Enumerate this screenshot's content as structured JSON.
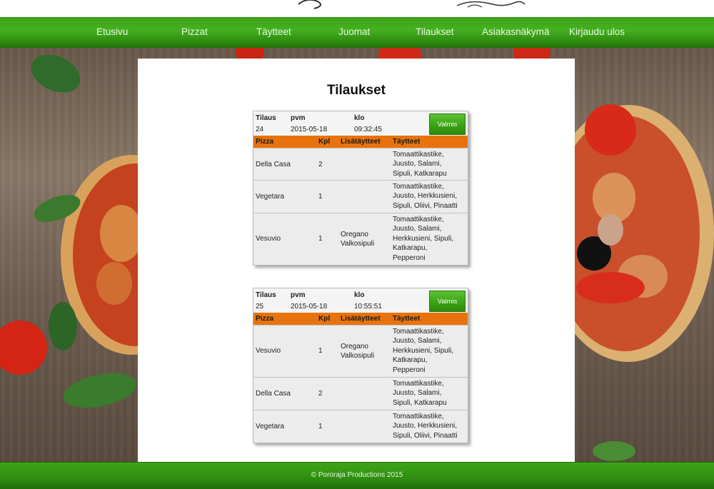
{
  "nav": {
    "items": [
      {
        "label": "Etusivu"
      },
      {
        "label": "Pizzat"
      },
      {
        "label": "Täytteet"
      },
      {
        "label": "Juomat"
      },
      {
        "label": "Tilaukset"
      },
      {
        "label": "Asiakasnäkymä"
      },
      {
        "label": "Kirjaudu ulos"
      }
    ]
  },
  "page": {
    "title": "Tilaukset"
  },
  "labels": {
    "order": "Tilaus",
    "date": "pvm",
    "time": "klo",
    "col_pizza": "Pizza",
    "col_qty": "Kpl",
    "col_extras": "Lisätäytteet",
    "col_toppings": "Täytteet",
    "done_button": "Valmis"
  },
  "orders": [
    {
      "id": "24",
      "date": "2015-05-18",
      "time": "09:32:45",
      "rows": [
        {
          "pizza": "Della Casa",
          "qty": "2",
          "extras": [
            "",
            ""
          ],
          "toppings": [
            "Tomaattikastike,",
            "Juusto, Salami,",
            "Sipuli, Katkarapu"
          ]
        },
        {
          "pizza": "Vegetara",
          "qty": "1",
          "extras": [
            "",
            ""
          ],
          "toppings": [
            "Tomaattikastike,",
            "Juusto, Herkkusieni,",
            "Sipuli, Oliivi, Pinaatti"
          ]
        },
        {
          "pizza": "Vesuvio",
          "qty": "1",
          "extras": [
            "Oregano",
            "Valkosipuli"
          ],
          "toppings": [
            "Tomaattikastike,",
            "Juusto, Salami,",
            "Herkkusieni, Sipuli,",
            "Katkarapu,",
            "Pepperoni"
          ]
        }
      ]
    },
    {
      "id": "25",
      "date": "2015-05-18",
      "time": "10:55:51",
      "rows": [
        {
          "pizza": "Vesuvio",
          "qty": "1",
          "extras": [
            "Oregano",
            "Valkosipuli"
          ],
          "toppings": [
            "Tomaattikastike,",
            "Juusto, Salami,",
            "Herkkusieni, Sipuli,",
            "Katkarapu,",
            "Pepperoni"
          ]
        },
        {
          "pizza": "Della Casa",
          "qty": "2",
          "extras": [
            "",
            ""
          ],
          "toppings": [
            "Tomaattikastike,",
            "Juusto, Salami,",
            "Sipuli, Katkarapu"
          ]
        },
        {
          "pizza": "Vegetara",
          "qty": "1",
          "extras": [
            "",
            ""
          ],
          "toppings": [
            "Tomaattikastike,",
            "Juusto, Herkkusieni,",
            "Sipuli, Oliivi, Pinaatti"
          ]
        }
      ]
    }
  ],
  "footer": {
    "text": "© Pororaja Productions 2015"
  },
  "colors": {
    "nav_green": "#3ea41a",
    "table_header_orange": "#e8730c",
    "button_green": "#38a013"
  }
}
